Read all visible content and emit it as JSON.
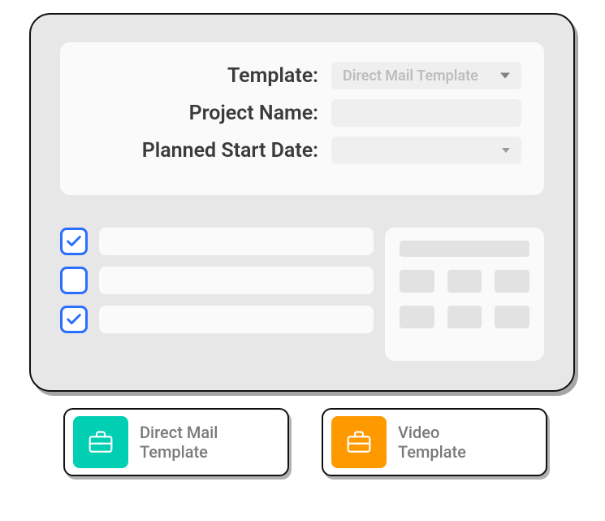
{
  "form": {
    "template_label": "Template:",
    "template_value": "Direct Mail Template",
    "project_name_label": "Project Name:",
    "project_name_value": "",
    "start_date_label": "Planned Start Date:",
    "start_date_value": ""
  },
  "checklist": {
    "items": [
      {
        "checked": true
      },
      {
        "checked": false
      },
      {
        "checked": true
      }
    ]
  },
  "templates": {
    "items": [
      {
        "name": "Direct Mail\nTemplate",
        "color": "#00cfb4"
      },
      {
        "name": "Video\nTemplate",
        "color": "#ff9900"
      }
    ]
  }
}
